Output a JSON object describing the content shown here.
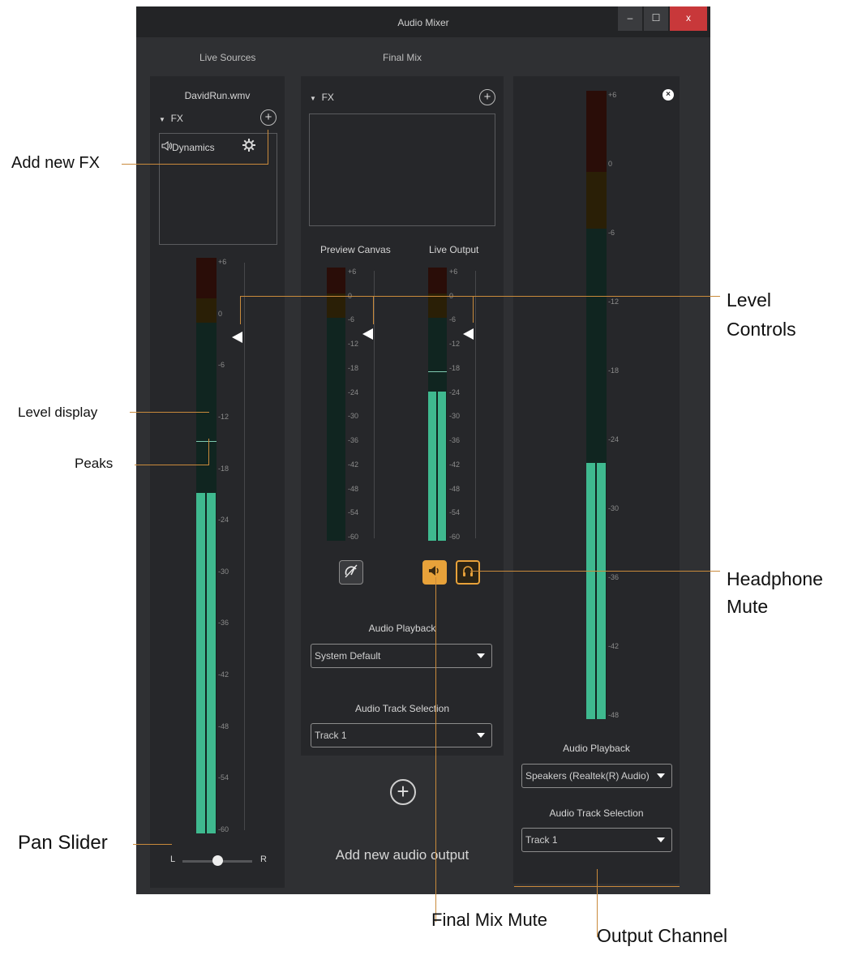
{
  "window": {
    "title": "Audio Mixer",
    "minimize_glyph": "–",
    "maximize_glyph": "☐",
    "close_glyph": "x"
  },
  "tabs": {
    "live_sources": "Live Sources",
    "final_mix": "Final Mix"
  },
  "source": {
    "name": "DavidRun.wmv",
    "fx_label": "FX",
    "fx_items": [
      {
        "label": "Dynamics",
        "icon": "speaker-icon"
      }
    ],
    "meter_scale": [
      "+6",
      "0",
      "-6",
      "-12",
      "-18",
      "-24",
      "-30",
      "-36",
      "-42",
      "-48",
      "-54",
      "-60"
    ],
    "level_db": -21,
    "peak_db": -15,
    "pan": {
      "left": "L",
      "right": "R",
      "value": 0.5
    }
  },
  "final_mix": {
    "fx_label": "FX",
    "preview_canvas_label": "Preview Canvas",
    "live_output_label": "Live Output",
    "meter_scale": [
      "+6",
      "0",
      "-6",
      "-12",
      "-18",
      "-24",
      "-30",
      "-36",
      "-42",
      "-48",
      "-54",
      "-60"
    ],
    "preview_level_db": -60,
    "live_level_db": -24,
    "live_peak_db": -19,
    "audio_playback_label": "Audio Playback",
    "audio_playback_value": "System Default",
    "audio_track_label": "Audio Track Selection",
    "audio_track_value": "Track 1",
    "add_output_label": "Add new audio output"
  },
  "output": {
    "meter_scale": [
      "+6",
      "0",
      "-6",
      "-12",
      "-18",
      "-24",
      "-30",
      "-36",
      "-42",
      "-48"
    ],
    "level_db": -26,
    "audio_playback_label": "Audio Playback",
    "audio_playback_value": "Speakers (Realtek(R) Audio)",
    "audio_track_label": "Audio Track Selection",
    "audio_track_value": "Track 1"
  },
  "callouts": {
    "add_fx": "Add new FX",
    "level_display": "Level display",
    "peaks": "Peaks",
    "pan_slider": "Pan Slider",
    "level_controls_1": "Level",
    "level_controls_2": "Controls",
    "headphone_mute_1": "Headphone",
    "headphone_mute_2": "Mute",
    "final_mix_mute": "Final Mix Mute",
    "output_channel": "Output Channel"
  },
  "colors": {
    "accent": "#e8a23a",
    "meter_green": "#3fb98f",
    "callout_line": "#c98a3b",
    "close_red": "#c8383a"
  }
}
